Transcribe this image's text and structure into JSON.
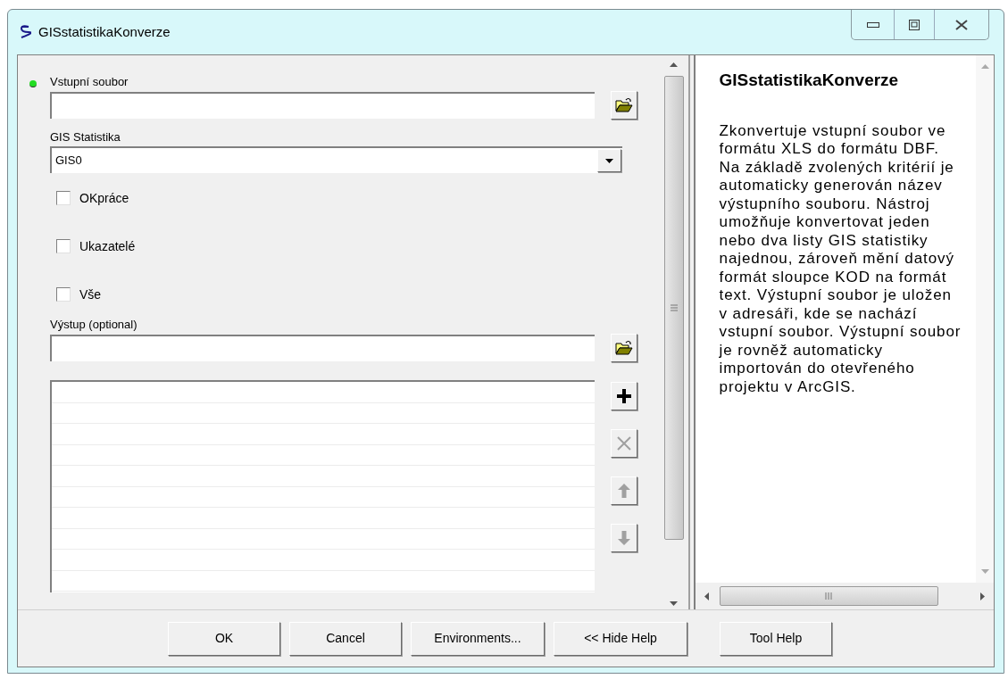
{
  "window": {
    "title": "GISstatistikaKonverze"
  },
  "form": {
    "fields": [
      {
        "kind": "file",
        "label": "Vstupní soubor",
        "required": true
      },
      {
        "kind": "dropdown",
        "label": "GIS Statistika",
        "value": "GIS0"
      },
      {
        "kind": "checkbox",
        "label": "OKpráce",
        "checked": false
      },
      {
        "kind": "checkbox",
        "label": "Ukazatelé",
        "checked": false
      },
      {
        "kind": "checkbox",
        "label": "Vše",
        "checked": false
      },
      {
        "kind": "file",
        "label": "Výstup (optional)"
      },
      {
        "kind": "list"
      }
    ]
  },
  "help": {
    "title": "GISstatistikaKonverze",
    "text": "Zkonvertuje vstupní soubor ve formátu XLS do formátu DBF. Na základě zvolených kritérií je automaticky generován název výstupního souboru. Nástroj umožňuje konvertovat jeden nebo dva listy GIS statistiky najednou, zároveň mění datový formát sloupce KOD na formát text. Výstupní soubor je uložen v adresáři, kde se nachází vstupní soubor. Výstupní soubor je rovněž automaticky importován do otevřeného projektu v ArcGIS."
  },
  "buttons": [
    "OK",
    "Cancel",
    "Environments...",
    "<< Hide Help",
    "Tool Help"
  ]
}
